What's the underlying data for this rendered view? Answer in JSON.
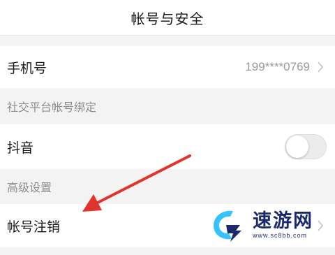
{
  "nav": {
    "title": "帐号与安全"
  },
  "phone": {
    "label": "手机号",
    "value": "199****0769",
    "chevron_icon": "chevron-right-icon"
  },
  "social_section": {
    "title": "社交平台帐号绑定"
  },
  "douyin": {
    "label": "抖音",
    "toggle_on": false
  },
  "advanced_section": {
    "title": "高级设置"
  },
  "cancel_account": {
    "label": "帐号注销",
    "chevron_icon": "chevron-right-icon"
  },
  "annotation": {
    "arrow_color": "#e0342c"
  },
  "watermark": {
    "name": "速游网",
    "url": "www.sc8bb.com",
    "colors": {
      "primary": "#1a2a6c",
      "accent": "#36c2ff"
    }
  }
}
